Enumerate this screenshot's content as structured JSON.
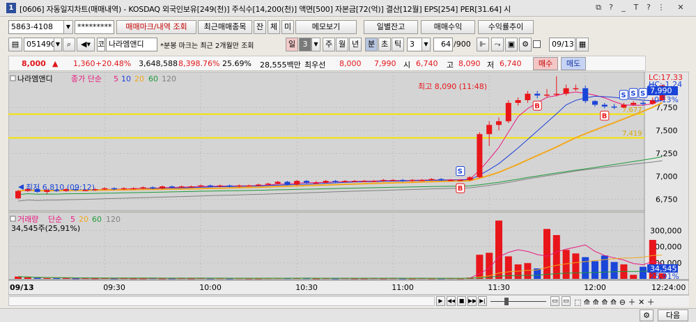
{
  "window": {
    "number": "1",
    "title": "[0606] 자동일지차트(매매내역) - KOSDAQ 외국인보유[249(천)] 주식수[14,200(천)] 액면[500] 자본금[72(억)] 결산[12월] EPS[254] PER[31.64] 시",
    "controls": [
      "⧉",
      "?",
      "_",
      "T",
      "?",
      "⋮",
      "✕"
    ]
  },
  "toolbar1": {
    "account": "5863-4108",
    "password": "*********",
    "btn_trade_mark": "매매마크/내역 조회",
    "btn_recent": "최근매매종목",
    "btn_jan": "잔",
    "btn_che": "체",
    "btn_mi": "미",
    "btn_memo": "메모보기",
    "btn_daily_balance": "일별잔고",
    "btn_trade_return": "매매수익",
    "btn_return_trend": "수익률추이"
  },
  "toolbar2": {
    "stock_code": "051490",
    "market_badge": "코",
    "stock_name": "나라엠앤디",
    "note": "*분봉 마크는 최근 2개월만 조회",
    "period_tabs": [
      "일",
      "3",
      "주",
      "월",
      "년",
      "분",
      "초",
      "틱"
    ],
    "interval": "3",
    "count": "64",
    "count_total": "/900",
    "date": "09/13"
  },
  "quote": {
    "price": "8,000",
    "change_arrow": "▲",
    "change": "1,360",
    "change_pct": "+20.48%",
    "volume": "3,648,588",
    "volume_ratio": "8,398.76%",
    "turnover_pct": "25.69%",
    "amount": "28,555백만",
    "best_label": "최우선",
    "best_ask": "8,000",
    "best_bid": "7,990",
    "open_label": "시",
    "open": "6,740",
    "high_label": "고",
    "high": "8,090",
    "low_label": "저",
    "low": "6,740",
    "buy_btn": "매수",
    "sell_btn": "매도"
  },
  "price_panel": {
    "stock_label": "나라엠앤디",
    "ma_label": "종가 단순",
    "ma_periods": [
      "5",
      "10",
      "20",
      "60",
      "120"
    ],
    "ma_colors": [
      "#e8197d",
      "#1d3fd8",
      "#f2a81d",
      "#1f9a3a",
      "#808080"
    ],
    "high_note": "최고 8,090 (11:48)",
    "low_note": "최저 6,810 (09:12)",
    "lc_label": "LC:17.33",
    "hc_label": "HC:-1.24",
    "current_tag": "7,990",
    "change_tag": "-0.13%",
    "hline1": "7,677",
    "hline2": "7,419",
    "yticks": [
      "7,750",
      "7,500",
      "7,250",
      "7,000",
      "6,750"
    ]
  },
  "volume_panel": {
    "label": "거래량",
    "ma_label": "단순",
    "ma_periods": [
      "5",
      "20",
      "60",
      "120"
    ],
    "info": "34,545주(25,91%)",
    "yticks": [
      "300,000",
      "200,000",
      "100,000"
    ],
    "current_tag": "34,545",
    "pct_tag": "25,91%"
  },
  "x_axis": {
    "date": "09/13",
    "labels": [
      "09:30",
      "10:00",
      "10:30",
      "11:00",
      "11:30",
      "12:00"
    ],
    "time_now": "12:24:00"
  },
  "statusbar": {
    "next_btn": "다음"
  },
  "chart_data": {
    "type": "candlestick",
    "interval": "3분",
    "x": [
      "09:03",
      "09:06",
      "09:09",
      "09:12",
      "09:15",
      "09:18",
      "09:21",
      "09:24",
      "09:27",
      "09:30",
      "09:33",
      "09:36",
      "09:39",
      "09:42",
      "09:45",
      "09:48",
      "09:51",
      "09:54",
      "09:57",
      "10:00",
      "10:03",
      "10:06",
      "10:09",
      "10:12",
      "10:15",
      "10:18",
      "10:21",
      "10:24",
      "10:27",
      "10:30",
      "10:33",
      "10:36",
      "10:39",
      "10:42",
      "10:45",
      "10:48",
      "10:51",
      "10:54",
      "10:57",
      "11:00",
      "11:03",
      "11:06",
      "11:09",
      "11:12",
      "11:15",
      "11:18",
      "11:21",
      "11:24",
      "11:27",
      "11:30",
      "11:33",
      "11:36",
      "11:39",
      "11:42",
      "11:45",
      "11:48",
      "11:51",
      "11:54",
      "11:57",
      "12:00",
      "12:03",
      "12:06",
      "12:09",
      "12:12",
      "12:15",
      "12:18",
      "12:21",
      "12:24"
    ],
    "open": [
      6760,
      6840,
      6860,
      6830,
      6850,
      6840,
      6860,
      6850,
      6850,
      6860,
      6870,
      6860,
      6870,
      6870,
      6880,
      6870,
      6890,
      6880,
      6890,
      6890,
      6900,
      6890,
      6900,
      6890,
      6900,
      6900,
      6910,
      6920,
      6940,
      6910,
      6950,
      6930,
      6930,
      6950,
      6940,
      6950,
      6950,
      6950,
      6950,
      6960,
      6960,
      6950,
      6960,
      6960,
      6970,
      6960,
      6960,
      6960,
      6990,
      7460,
      7560,
      7600,
      7800,
      7830,
      7900,
      7880,
      7890,
      7900,
      7960,
      7960,
      7820,
      7780,
      7760,
      7750,
      7780,
      7800,
      7790,
      7830
    ],
    "close": [
      6840,
      6860,
      6830,
      6850,
      6840,
      6860,
      6850,
      6850,
      6860,
      6870,
      6860,
      6870,
      6870,
      6880,
      6870,
      6890,
      6880,
      6890,
      6890,
      6900,
      6890,
      6900,
      6890,
      6900,
      6900,
      6910,
      6920,
      6940,
      6910,
      6950,
      6930,
      6930,
      6950,
      6940,
      6950,
      6950,
      6950,
      6950,
      6960,
      6960,
      6950,
      6960,
      6960,
      6970,
      6960,
      6960,
      6960,
      6990,
      7460,
      7560,
      7600,
      7800,
      7830,
      7900,
      7880,
      7890,
      7900,
      7960,
      7960,
      7820,
      7780,
      7760,
      7750,
      7780,
      7800,
      7790,
      7830,
      7990
    ],
    "high": [
      6850,
      6870,
      6870,
      6860,
      6860,
      6870,
      6870,
      6860,
      6870,
      6880,
      6880,
      6880,
      6880,
      6890,
      6890,
      6900,
      6900,
      6900,
      6900,
      6910,
      6910,
      6910,
      6910,
      6910,
      6910,
      6920,
      6930,
      6950,
      6950,
      6960,
      6960,
      6950,
      6960,
      6960,
      6960,
      6960,
      6960,
      6960,
      6970,
      6970,
      6970,
      6970,
      6970,
      6980,
      6980,
      6970,
      6970,
      7000,
      7480,
      7600,
      7640,
      7830,
      7860,
      7930,
      7930,
      7950,
      8090,
      8000,
      8000,
      7990,
      7830,
      7800,
      7790,
      7800,
      7820,
      7820,
      7860,
      8000
    ],
    "low": [
      6750,
      6830,
      6820,
      6810,
      6830,
      6830,
      6840,
      6840,
      6840,
      6850,
      6850,
      6850,
      6860,
      6860,
      6860,
      6860,
      6870,
      6870,
      6880,
      6880,
      6880,
      6880,
      6880,
      6880,
      6890,
      6890,
      6900,
      6910,
      6900,
      6900,
      6920,
      6920,
      6920,
      6930,
      6930,
      6940,
      6940,
      6940,
      6940,
      6950,
      6940,
      6940,
      6950,
      6950,
      6950,
      6950,
      6950,
      6950,
      6980,
      7330,
      7500,
      7580,
      7770,
      7800,
      7850,
      7860,
      7870,
      7880,
      7930,
      7800,
      7760,
      7740,
      7730,
      7740,
      7770,
      7770,
      7780,
      7820
    ],
    "volume": [
      14000,
      9000,
      6000,
      5000,
      4000,
      5000,
      3000,
      4000,
      3000,
      5000,
      3000,
      4000,
      3000,
      3000,
      4000,
      3000,
      3000,
      4000,
      3000,
      5000,
      3000,
      4000,
      3000,
      4000,
      3000,
      3000,
      4000,
      6000,
      4000,
      5000,
      4000,
      3000,
      4000,
      3000,
      4000,
      3000,
      3000,
      4000,
      3000,
      4000,
      3000,
      3000,
      4000,
      3000,
      3000,
      4000,
      3000,
      8000,
      150000,
      162000,
      362000,
      140000,
      90000,
      98000,
      65000,
      310000,
      272000,
      180000,
      158000,
      135000,
      110000,
      145000,
      105000,
      90000,
      25000,
      75000,
      242000,
      34545
    ],
    "ylim_price": [
      6640,
      8080
    ],
    "ylim_volume": [
      0,
      380000
    ],
    "horizontal_lines": [
      7677,
      7419
    ],
    "trade_marks": [
      {
        "time": "11:21",
        "side": "B"
      },
      {
        "time": "11:21",
        "side": "S"
      },
      {
        "time": "11:45",
        "side": "B"
      },
      {
        "time": "12:06",
        "side": "B"
      },
      {
        "time": "12:12",
        "side": "S"
      },
      {
        "time": "12:15",
        "side": "S"
      },
      {
        "time": "12:18",
        "side": "S"
      },
      {
        "time": "12:21",
        "side": "S"
      }
    ]
  }
}
